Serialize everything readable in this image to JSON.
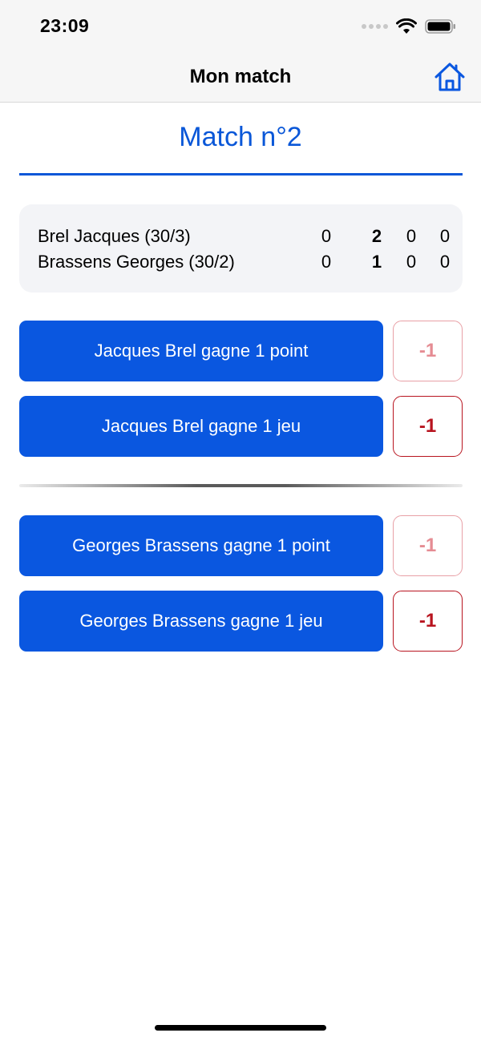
{
  "status_bar": {
    "time": "23:09"
  },
  "nav": {
    "title": "Mon match"
  },
  "match": {
    "title": "Match n°2"
  },
  "scoreboard": {
    "rows": [
      {
        "name": "Brel Jacques (30/3)",
        "scores": [
          "0",
          "2",
          "0",
          "0"
        ]
      },
      {
        "name": "Brassens Georges (30/2)",
        "scores": [
          "0",
          "1",
          "0",
          "0"
        ]
      }
    ]
  },
  "actions": {
    "player1_point": "Jacques Brel gagne 1 point",
    "player1_game": "Jacques Brel gagne 1 jeu",
    "player2_point": "Georges Brassens gagne 1 point",
    "player2_game": "Georges Brassens gagne 1 jeu",
    "undo_label": "-1"
  },
  "colors": {
    "accent": "#0a57e0",
    "undo_dark": "#b8141f",
    "undo_light": "#e58c93"
  }
}
